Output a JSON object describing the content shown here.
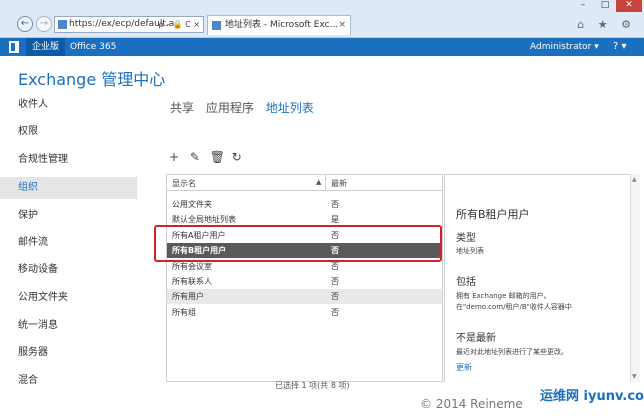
{
  "browser": {
    "url": "https://ex/ecp/default.a",
    "url_tools": "ρ – 🔒 C ×",
    "tab_title": "地址列表 - Microsoft Exc...",
    "tab_close": "×",
    "window_controls": {
      "min": "–",
      "max": "□",
      "close": "✕"
    },
    "right_icons": "⌂ ★ ⚙"
  },
  "suite": {
    "tabs": [
      "企业版",
      "Office 365"
    ],
    "user": "Administrator ▾",
    "help": "? ▾"
  },
  "app_title": "Exchange 管理中心",
  "nav": {
    "items": [
      "收件人",
      "权限",
      "合规性管理",
      "组织",
      "保护",
      "邮件流",
      "移动设备",
      "公用文件夹",
      "统一消息",
      "服务器",
      "混合"
    ],
    "active_index": 3
  },
  "subtabs": [
    "共享",
    "应用程序",
    "地址列表"
  ],
  "toolbar": {
    "add": "+",
    "edit": "✎",
    "delete": "🗑",
    "refresh": "↻"
  },
  "table": {
    "col_name": "显示名",
    "sort_indicator": "▲",
    "col_new": "最新",
    "rows": [
      {
        "name": "公用文件夹",
        "new": "否"
      },
      {
        "name": "默认全局地址列表",
        "new": "是"
      },
      {
        "name": "所有A租户用户",
        "new": "否"
      },
      {
        "name": "所有B租户用户",
        "new": "否"
      },
      {
        "name": "所有会议室",
        "new": "否"
      },
      {
        "name": "所有联系人",
        "new": "否"
      },
      {
        "name": "所有用户",
        "new": "否"
      },
      {
        "name": "所有组",
        "new": "否"
      }
    ],
    "selected_index": 3,
    "status": "已选择 1 项(共 8 项)"
  },
  "details": {
    "title": "所有B租户用户",
    "type_heading": "类型",
    "type_value": "地址列表",
    "includes_heading": "包括",
    "includes_line1": "拥有 Exchange 邮箱的用户。",
    "includes_line2": "在\"demo.com/租户/B\"收件人容器中",
    "stale_heading": "不是最新",
    "stale_text": "最近对此地址列表进行了某些更改。",
    "update_link": "更新",
    "scroll_up": "▲",
    "scroll_down": "▼"
  },
  "footer": {
    "copyright": "© 2014 Reineme",
    "watermark": "运维网 iyunv.com"
  },
  "colors": {
    "accent": "#1a6fbf",
    "selected_row": "#5a5a5a",
    "highlight": "#d2232a"
  }
}
